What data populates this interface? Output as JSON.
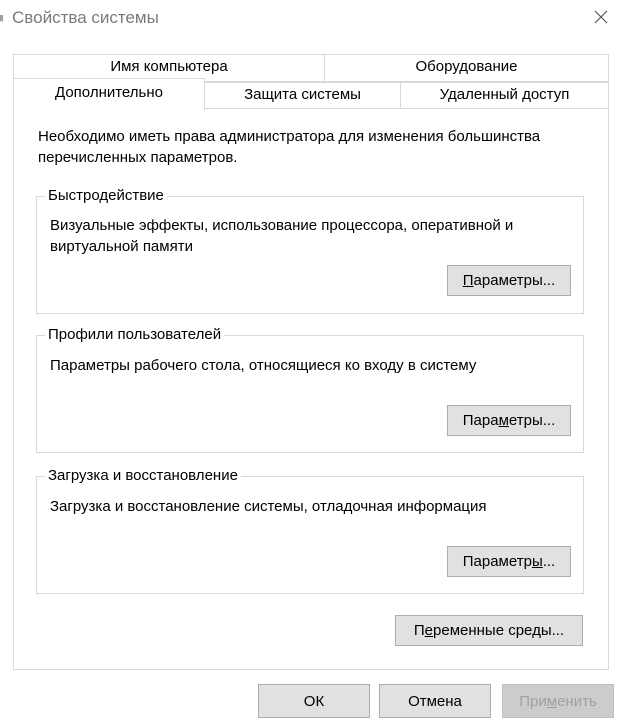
{
  "window": {
    "title": "Свойства системы",
    "title_icon": "app-icon",
    "close_icon": "close-icon"
  },
  "tabs": {
    "row1": [
      {
        "label": "Имя компьютера"
      },
      {
        "label": "Оборудование"
      }
    ],
    "row2": [
      {
        "label": "Дополнительно",
        "selected": true
      },
      {
        "label": "Защита системы"
      },
      {
        "label": "Удаленный доступ"
      }
    ]
  },
  "panel": {
    "intro": "Необходимо иметь права администратора для изменения большинства перечисленных параметров.",
    "groups": [
      {
        "title": "Быстродействие",
        "description": "Визуальные эффекты, использование процессора, оперативной и виртуальной памяти",
        "button": {
          "before": "",
          "underlined": "П",
          "after": "араметры..."
        }
      },
      {
        "title": "Профили пользователей",
        "description": "Параметры рабочего стола, относящиеся ко входу в систему",
        "button": {
          "before": "Пара",
          "underlined": "м",
          "after": "етры..."
        }
      },
      {
        "title": "Загрузка и восстановление",
        "description": "Загрузка и восстановление системы, отладочная информация",
        "button": {
          "before": "Параметр",
          "underlined": "ы",
          "after": "..."
        }
      }
    ],
    "env_button": {
      "before": "П",
      "underlined": "е",
      "after": "ременные среды..."
    }
  },
  "footer": {
    "ok": "ОК",
    "cancel": "Отмена",
    "apply": {
      "before": "При",
      "underlined": "м",
      "after": "енить",
      "disabled": true
    }
  }
}
